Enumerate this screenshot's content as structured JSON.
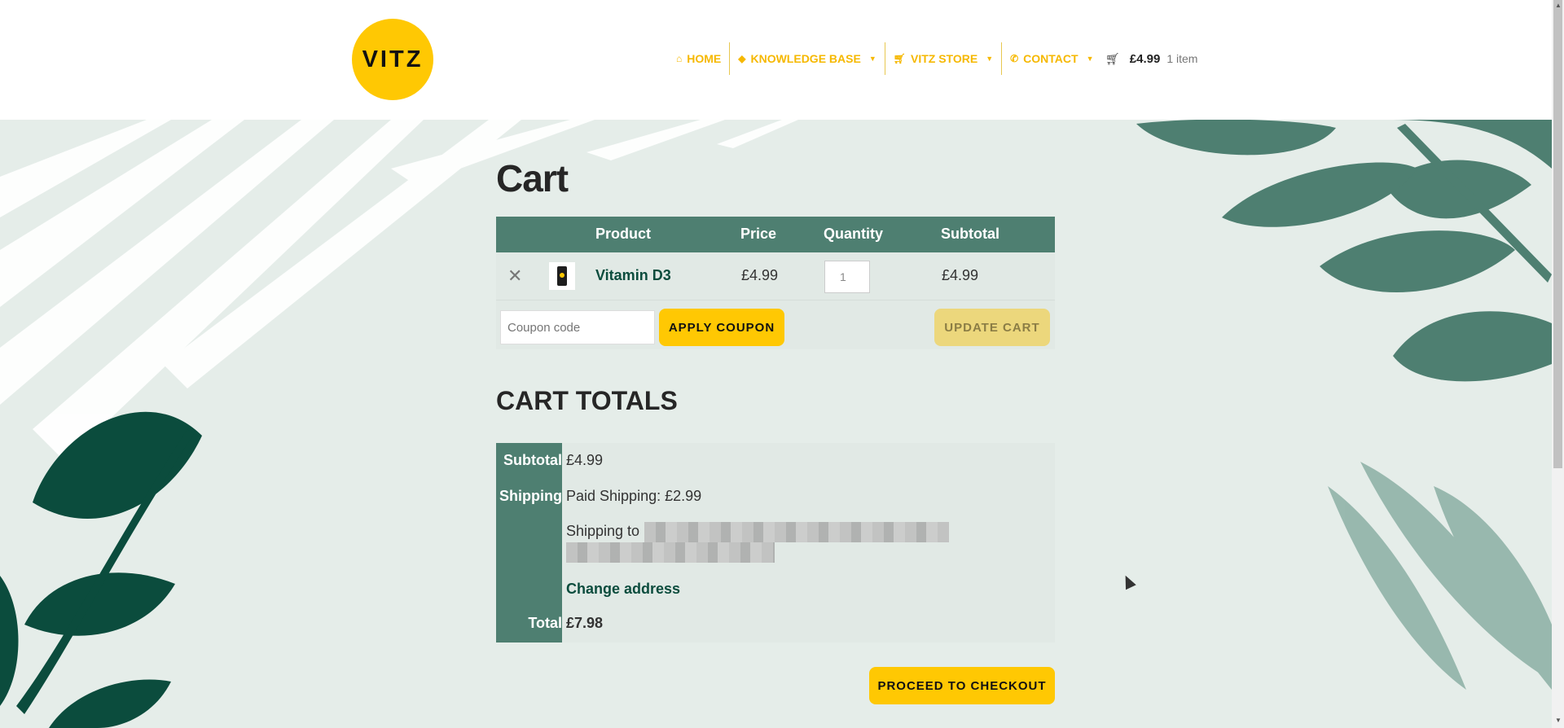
{
  "brand": {
    "logo_text": "VITZ",
    "accent": "#ffc803",
    "dark_green": "#0b4c3d",
    "table_green": "#4e7f71"
  },
  "nav": {
    "items": [
      {
        "label": "HOME",
        "icon": "home-icon"
      },
      {
        "label": "KNOWLEDGE BASE",
        "icon": "graduation-cap-icon"
      },
      {
        "label": "VITZ STORE",
        "icon": "cart-icon"
      },
      {
        "label": "CONTACT",
        "icon": "phone-icon"
      }
    ]
  },
  "mini_cart": {
    "amount": "£4.99",
    "count": "1 item"
  },
  "page": {
    "title": "Cart"
  },
  "cart": {
    "headers": {
      "product": "Product",
      "price": "Price",
      "quantity": "Quantity",
      "subtotal": "Subtotal"
    },
    "items": [
      {
        "name": "Vitamin D3",
        "price": "£4.99",
        "quantity": "1",
        "subtotal": "£4.99"
      }
    ],
    "coupon_placeholder": "Coupon code",
    "apply_label": "APPLY COUPON",
    "update_label": "UPDATE CART"
  },
  "totals": {
    "title": "CART TOTALS",
    "subtotal_label": "Subtotal",
    "subtotal_value": "£4.99",
    "shipping_label": "Shipping",
    "shipping_method": "Paid Shipping: £2.99",
    "shipping_to_label": "Shipping to",
    "change_address_label": "Change address",
    "total_label": "Total",
    "total_value": "£7.98",
    "checkout_label": "PROCEED TO CHECKOUT"
  }
}
